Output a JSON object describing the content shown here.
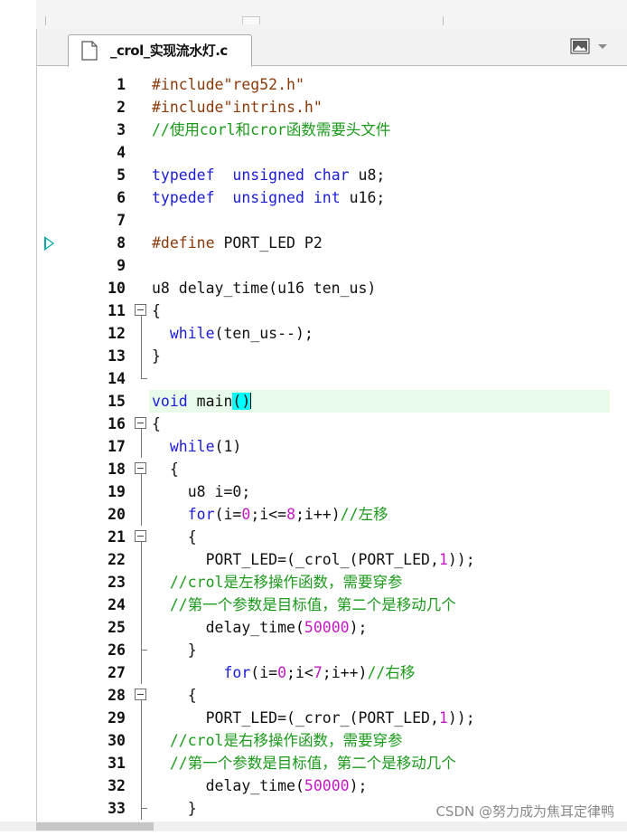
{
  "editor": {
    "tab_title": "_crol_实现流水灯.c",
    "icons": {
      "file": "file-icon",
      "view": "picture-icon",
      "dropdown": "chevron-down-icon",
      "breakpoint": "breakpoint-arrow-icon"
    },
    "colors": {
      "keyword": "#1c1cd6",
      "preprocessor": "#8b3a0a",
      "comment": "#1b9a1b",
      "number": "#c21bc2",
      "current_line": "#e9fbe9",
      "bracket_match": "#00ffff"
    }
  },
  "code": {
    "lines": [
      {
        "n": "1",
        "tokens": [
          [
            "pp",
            "#include"
          ],
          [
            "str",
            "\"reg52.h\""
          ]
        ]
      },
      {
        "n": "2",
        "tokens": [
          [
            "pp",
            "#include"
          ],
          [
            "str",
            "\"intrins.h\""
          ]
        ]
      },
      {
        "n": "3",
        "tokens": [
          [
            "cm",
            "//使用corl和cror函数需要头文件"
          ]
        ]
      },
      {
        "n": "4",
        "tokens": []
      },
      {
        "n": "5",
        "tokens": [
          [
            "kw",
            "typedef"
          ],
          [
            "",
            "  "
          ],
          [
            "kw",
            "unsigned"
          ],
          [
            "",
            " "
          ],
          [
            "kw",
            "char"
          ],
          [
            "",
            " u8;"
          ]
        ]
      },
      {
        "n": "6",
        "tokens": [
          [
            "kw",
            "typedef"
          ],
          [
            "",
            "  "
          ],
          [
            "kw",
            "unsigned"
          ],
          [
            "",
            " "
          ],
          [
            "kw",
            "int"
          ],
          [
            "",
            " u16;"
          ]
        ]
      },
      {
        "n": "7",
        "tokens": []
      },
      {
        "n": "8",
        "tokens": [
          [
            "pp",
            "#define"
          ],
          [
            "",
            " PORT_LED P2"
          ]
        ],
        "breakpoint": true
      },
      {
        "n": "9",
        "tokens": []
      },
      {
        "n": "10",
        "tokens": [
          [
            "",
            "u8 delay_time(u16 ten_us)"
          ]
        ]
      },
      {
        "n": "11",
        "tokens": [
          [
            "",
            "{"
          ]
        ],
        "fold": "box"
      },
      {
        "n": "12",
        "tokens": [
          [
            "",
            "  "
          ],
          [
            "kw",
            "while"
          ],
          [
            "",
            "(ten_us--);"
          ]
        ],
        "fold": "line"
      },
      {
        "n": "13",
        "tokens": [
          [
            "",
            "}"
          ]
        ],
        "fold": "line"
      },
      {
        "n": "14",
        "tokens": [],
        "fold": "end"
      },
      {
        "n": "15",
        "tokens": [
          [
            "kw",
            "void"
          ],
          [
            "",
            " main"
          ],
          [
            "brk",
            "()"
          ],
          [
            "caret",
            ""
          ]
        ],
        "highlight": true
      },
      {
        "n": "16",
        "tokens": [
          [
            "",
            "{"
          ]
        ],
        "fold": "box"
      },
      {
        "n": "17",
        "tokens": [
          [
            "",
            "  "
          ],
          [
            "kw",
            "while"
          ],
          [
            "",
            "(1)"
          ]
        ],
        "fold": "line"
      },
      {
        "n": "18",
        "tokens": [
          [
            "",
            "  {"
          ]
        ],
        "fold": "box"
      },
      {
        "n": "19",
        "tokens": [
          [
            "",
            "    u8 i=0;"
          ]
        ],
        "fold": "line"
      },
      {
        "n": "20",
        "tokens": [
          [
            "",
            "    "
          ],
          [
            "kw",
            "for"
          ],
          [
            "",
            "(i="
          ],
          [
            "num",
            "0"
          ],
          [
            "",
            ";i<="
          ],
          [
            "num",
            "8"
          ],
          [
            "",
            ";i++)"
          ],
          [
            "cm",
            "//左移"
          ]
        ],
        "fold": "line"
      },
      {
        "n": "21",
        "tokens": [
          [
            "",
            "    {"
          ]
        ],
        "fold": "box"
      },
      {
        "n": "22",
        "tokens": [
          [
            "",
            "      PORT_LED=(_crol_(PORT_LED,"
          ],
          [
            "num",
            "1"
          ],
          [
            "",
            "));"
          ]
        ],
        "fold": "line"
      },
      {
        "n": "23",
        "tokens": [
          [
            "",
            "  "
          ],
          [
            "cm",
            "//crol是左移操作函数，需要穿参"
          ]
        ],
        "fold": "line"
      },
      {
        "n": "24",
        "tokens": [
          [
            "",
            "  "
          ],
          [
            "cm",
            "//第一个参数是目标值，第二个是移动几个"
          ]
        ],
        "fold": "line"
      },
      {
        "n": "25",
        "tokens": [
          [
            "",
            "      delay_time("
          ],
          [
            "num",
            "50000"
          ],
          [
            "",
            ");"
          ]
        ],
        "fold": "line"
      },
      {
        "n": "26",
        "tokens": [
          [
            "",
            "    }"
          ]
        ],
        "fold": "tee"
      },
      {
        "n": "27",
        "tokens": [
          [
            "",
            "        "
          ],
          [
            "kw",
            "for"
          ],
          [
            "",
            "(i="
          ],
          [
            "num",
            "0"
          ],
          [
            "",
            ";i<"
          ],
          [
            "num",
            "7"
          ],
          [
            "",
            ";i++)"
          ],
          [
            "cm",
            "//右移"
          ]
        ],
        "fold": "line"
      },
      {
        "n": "28",
        "tokens": [
          [
            "",
            "    {"
          ]
        ],
        "fold": "box"
      },
      {
        "n": "29",
        "tokens": [
          [
            "",
            "      PORT_LED=(_cror_(PORT_LED,"
          ],
          [
            "num",
            "1"
          ],
          [
            "",
            "));"
          ]
        ],
        "fold": "line"
      },
      {
        "n": "30",
        "tokens": [
          [
            "",
            "  "
          ],
          [
            "cm",
            "//crol是右移操作函数，需要穿参"
          ]
        ],
        "fold": "line"
      },
      {
        "n": "31",
        "tokens": [
          [
            "",
            "  "
          ],
          [
            "cm",
            "//第一个参数是目标值，第二个是移动几个"
          ]
        ],
        "fold": "line"
      },
      {
        "n": "32",
        "tokens": [
          [
            "",
            "      delay_time("
          ],
          [
            "num",
            "50000"
          ],
          [
            "",
            ");"
          ]
        ],
        "fold": "line"
      },
      {
        "n": "33",
        "tokens": [
          [
            "",
            "    }"
          ]
        ],
        "fold": "tee"
      }
    ]
  },
  "watermark": "CSDN @努力成为焦耳定律鸭"
}
